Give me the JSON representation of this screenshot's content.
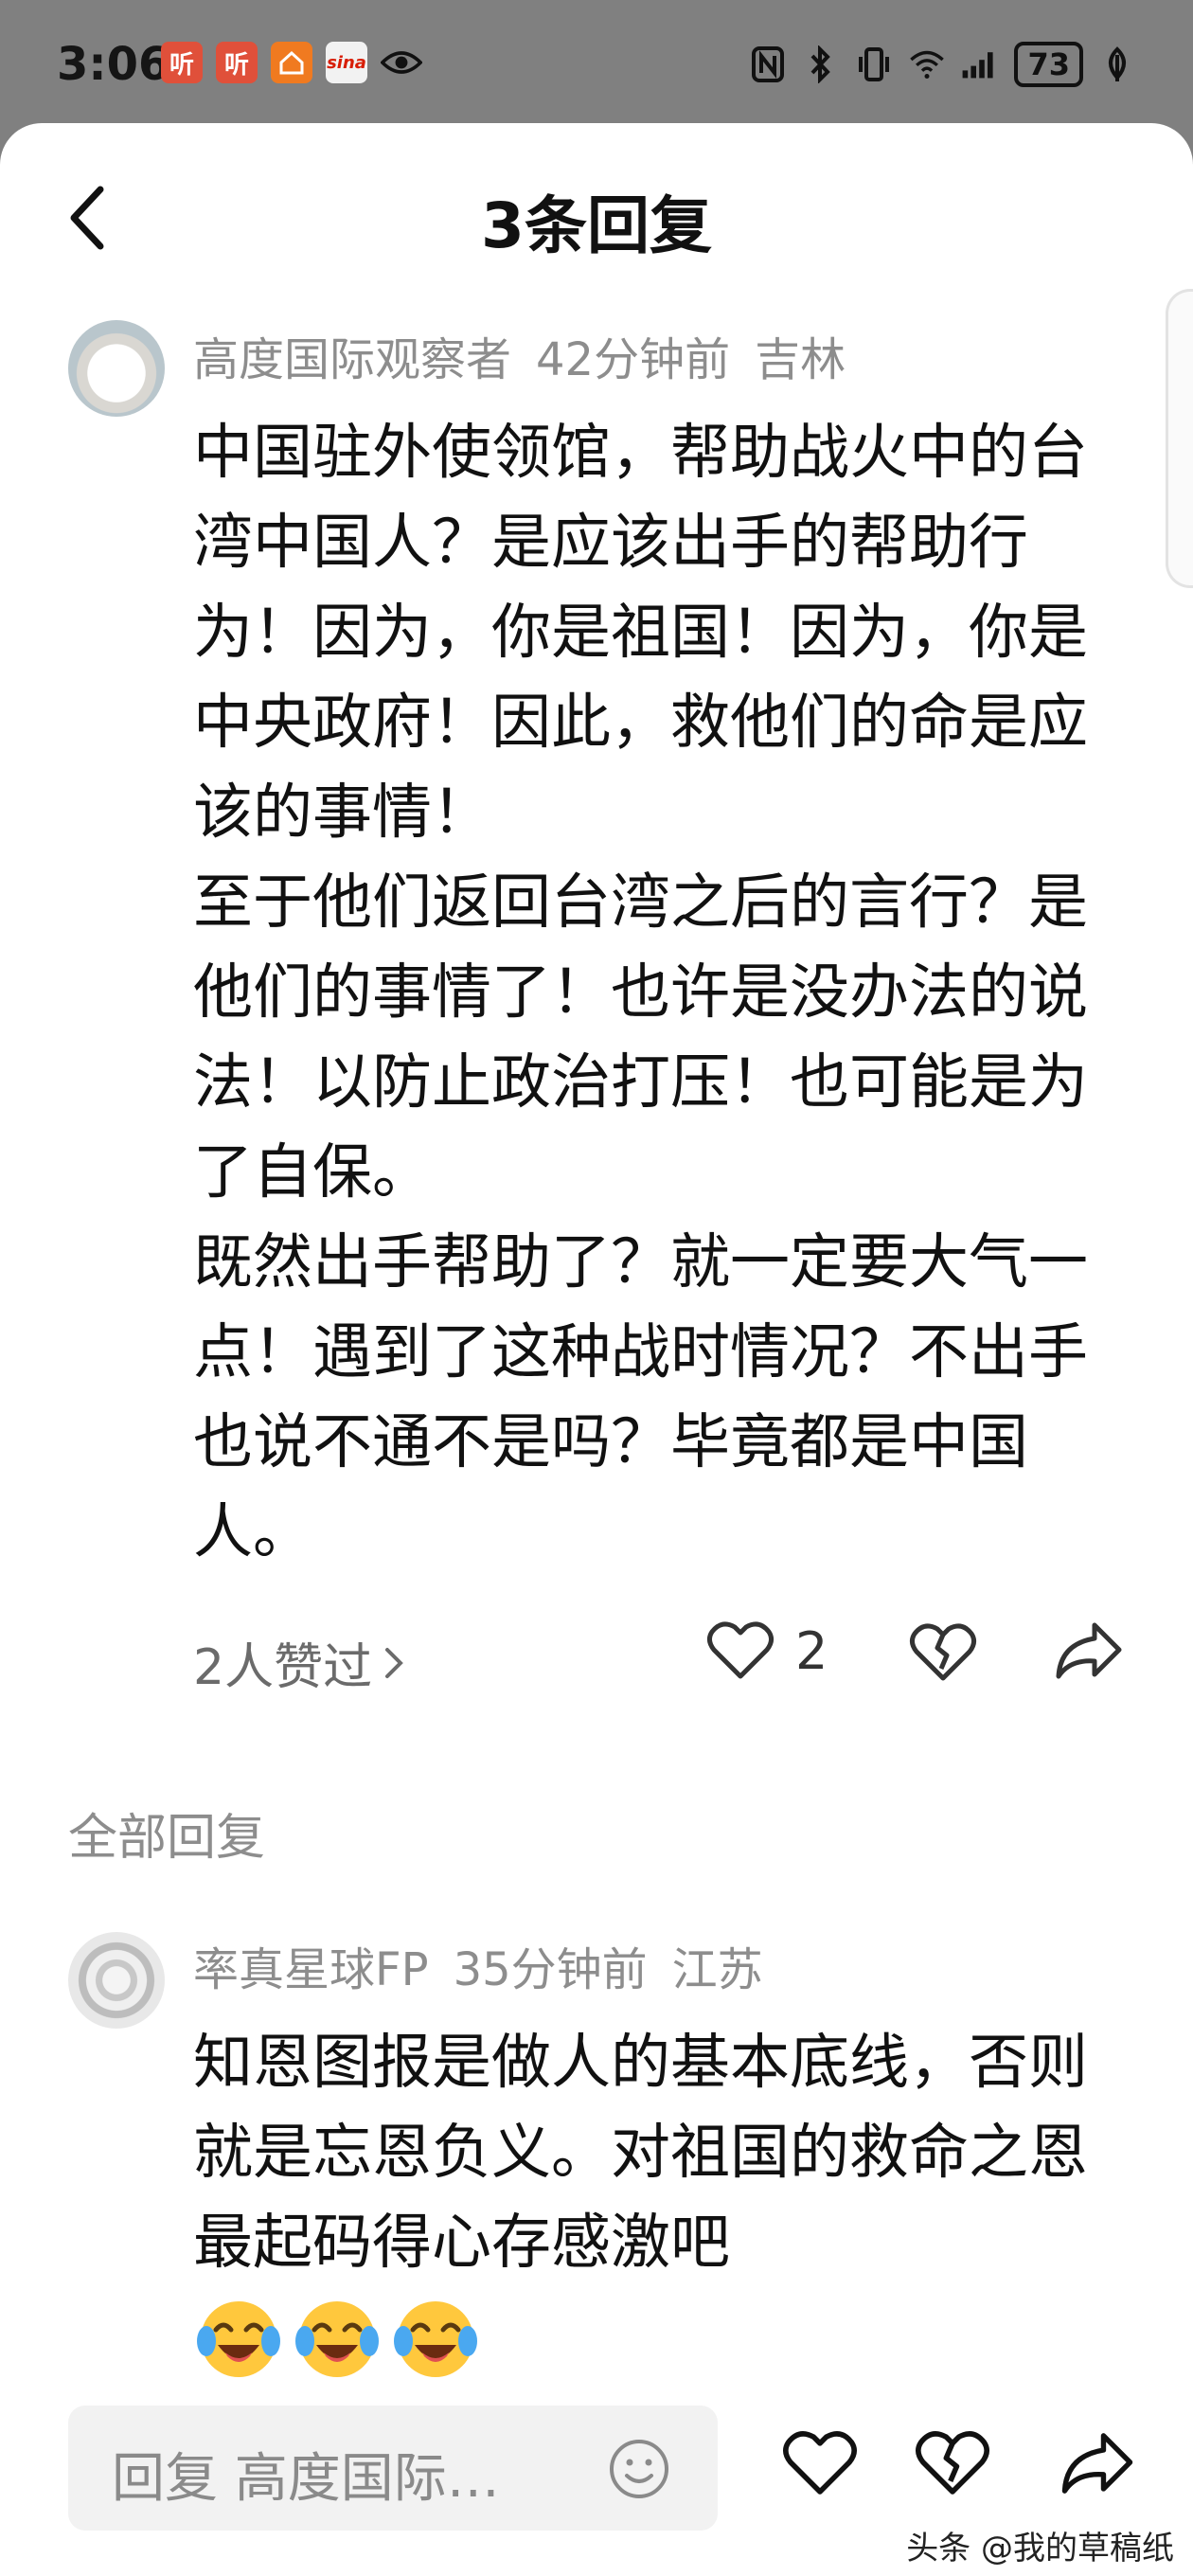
{
  "status_bar": {
    "time": "3:06",
    "battery": "73",
    "notification_icons": [
      "ting-app-icon",
      "ting-app-icon",
      "house-app-icon",
      "sina-app-icon",
      "eye-icon"
    ],
    "sina_label": "sina"
  },
  "header": {
    "title": "3条回复"
  },
  "main_comment": {
    "author": "高度国际观察者",
    "time": "42分钟前",
    "location": "吉林",
    "paragraphs": [
      "中国驻外使领馆，帮助战火中的台湾中国人？是应该出手的帮助行为！因为，你是祖国！因为，你是中央政府！因此，救他们的命是应该的事情！",
      "至于他们返回台湾之后的言行？是他们的事情了！也许是没办法的说法！以防止政治打压！也可能是为了自保。",
      "既然出手帮助了？就一定要大气一点！遇到了这种战时情况？不出手也说不通不是吗？毕竟都是中国人。"
    ],
    "likes_summary": "2人赞过",
    "like_count": "2"
  },
  "section_label": "全部回复",
  "reply": {
    "author": "率真星球FP",
    "time": "35分钟前",
    "location": "江苏",
    "text": "知恩图报是做人的基本底线，否则就是忘恩负义。对祖国的救命之恩最起码得心存感激吧",
    "emoji_count": 3
  },
  "reply_bar": {
    "placeholder": "回复 高度国际…"
  },
  "watermark": "头条 @我的草稿纸",
  "colors": {
    "sheet_bg": "#ffffff",
    "status_bg": "#808080",
    "meta_text": "#8d8d8d",
    "reply_box_bg": "#f2f2f2"
  }
}
